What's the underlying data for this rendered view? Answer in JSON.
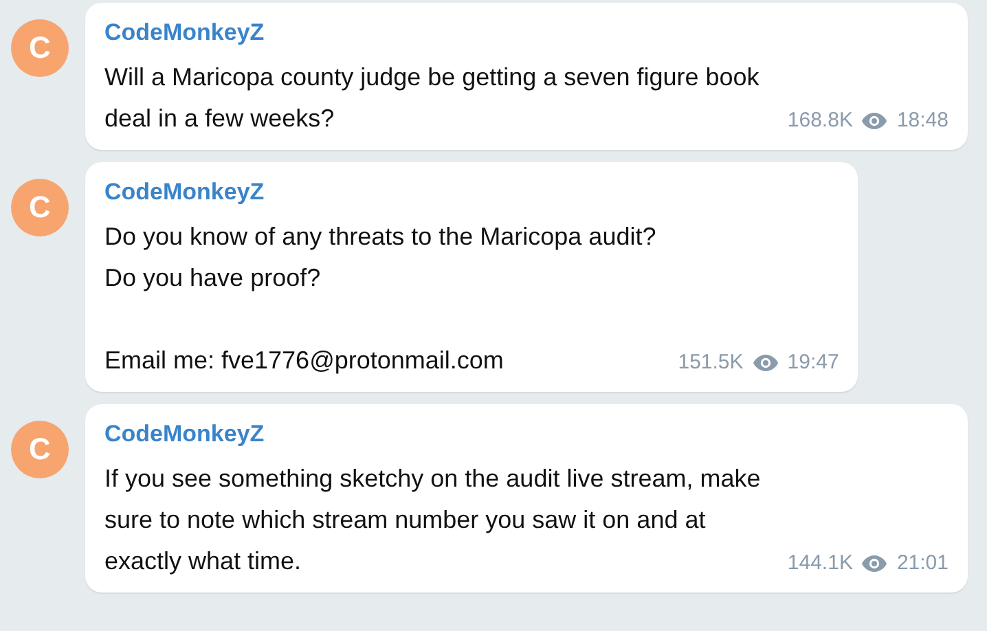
{
  "messages": [
    {
      "avatar": "C",
      "author": "CodeMonkeyZ",
      "text": "Will a Maricopa county judge be getting a seven figure book deal in a few weeks?",
      "views": "168.8K",
      "time": "18:48"
    },
    {
      "avatar": "C",
      "author": "CodeMonkeyZ",
      "text": "Do you know of any threats to the Maricopa audit?\nDo you have proof?\n\nEmail me: fve1776@protonmail.com",
      "views": "151.5K",
      "time": "19:47"
    },
    {
      "avatar": "C",
      "author": "CodeMonkeyZ",
      "text": "If you see something sketchy on the audit live stream, make sure to note which stream number you saw it on and at exactly what time.",
      "views": "144.1K",
      "time": "21:01"
    }
  ]
}
